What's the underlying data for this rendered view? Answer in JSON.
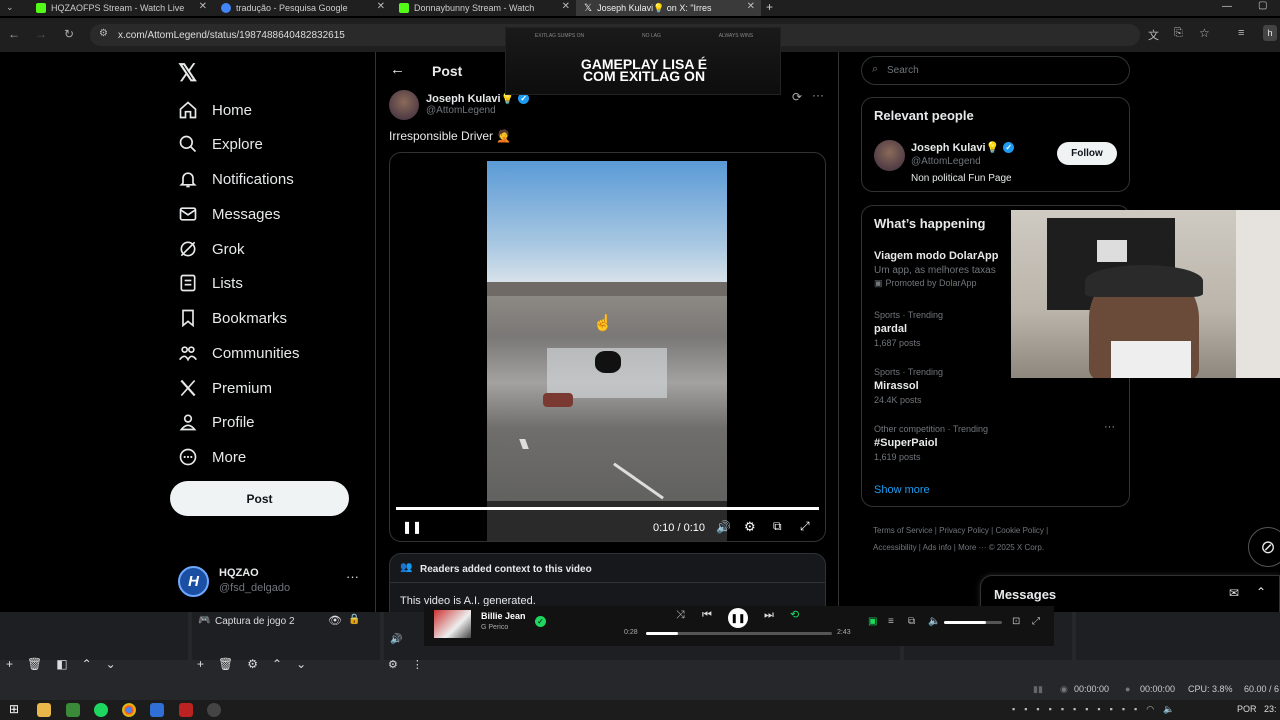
{
  "browser": {
    "tabs": [
      {
        "label": "HQZAOFPS Stream - Watch Live",
        "color": "#53fc18"
      },
      {
        "label": "tradução - Pesquisa Google",
        "color": "#4285f4"
      },
      {
        "label": "Donnaybunny Stream - Watch",
        "color": "#53fc18"
      },
      {
        "label": "Joseph Kulavi💡 on X: \"Irres",
        "color": "#ffffff"
      }
    ],
    "url": "x.com/AttomLegend/status/1987488640482832615"
  },
  "overlay_banner": {
    "top_labels": [
      "EXITLAG SUMPS ON",
      "NO LAG",
      "ALWAYS WINS"
    ],
    "text_line1": "GAMEPLAY LISA É",
    "text_line2": "COM EXITLAG ON"
  },
  "sidebar": {
    "items": [
      {
        "label": "Home",
        "icon": "home-icon"
      },
      {
        "label": "Explore",
        "icon": "search-icon"
      },
      {
        "label": "Notifications",
        "icon": "bell-icon"
      },
      {
        "label": "Messages",
        "icon": "mail-icon"
      },
      {
        "label": "Grok",
        "icon": "grok-icon"
      },
      {
        "label": "Lists",
        "icon": "list-icon"
      },
      {
        "label": "Bookmarks",
        "icon": "bookmark-icon"
      },
      {
        "label": "Communities",
        "icon": "communities-icon"
      },
      {
        "label": "Premium",
        "icon": "x-icon"
      },
      {
        "label": "Profile",
        "icon": "person-icon"
      },
      {
        "label": "More",
        "icon": "more-circle-icon"
      }
    ],
    "post_label": "Post",
    "account": {
      "name": "HQZAO",
      "handle": "@fsd_delgado",
      "initial": "H"
    }
  },
  "post": {
    "header_title": "Post",
    "author_name": "Joseph Kulavi💡",
    "author_handle": "@AttomLegend",
    "text": "Irresponsible Driver 🤦",
    "video_time": "0:10 / 0:10",
    "video_progress": 1.0,
    "community_note_title": "Readers added context to this video",
    "community_note_text": "This video is A.I. generated."
  },
  "right": {
    "search_placeholder": "Search",
    "relevant_title": "Relevant people",
    "person": {
      "name": "Joseph Kulavi💡",
      "handle": "@AttomLegend",
      "bio": "Non political Fun Page",
      "follow_label": "Follow"
    },
    "happening_title": "What’s happening",
    "promo": {
      "title": "Viagem modo DolarApp",
      "subtitle": "Um app, as melhores taxas",
      "promoted": "Promoted by DolarApp"
    },
    "trends": [
      {
        "meta": "Sports · Trending",
        "title": "pardal",
        "count": "1,687 posts"
      },
      {
        "meta": "Sports · Trending",
        "title": "Mirassol",
        "count": "24.4K posts"
      },
      {
        "meta": "Other competition · Trending",
        "title": "#SuperPaiol",
        "count": "1,619 posts"
      }
    ],
    "show_more": "Show more",
    "footer_links": [
      "Terms of Service",
      "Privacy Policy",
      "Cookie Policy",
      "Accessibility",
      "Ads info",
      "More ···",
      "© 2025 X Corp."
    ],
    "messages_label": "Messages"
  },
  "obs": {
    "source_name": "Captura de jogo 2",
    "track_title": "Billie Jean",
    "track_artist": "G Perico",
    "time_elapsed": "0:28",
    "time_total": "2:43",
    "track_progress": 0.17,
    "status_time1": "00:00:00",
    "status_time2": "00:00:00",
    "cpu": "CPU: 3.8%",
    "fps": "60.00 / 6"
  },
  "taskbar": {
    "lang": "POR",
    "clock": "23:"
  },
  "colors": {
    "x_blue": "#1d9bf0",
    "bg": "#000000",
    "border": "#2f3336",
    "muted": "#71767b",
    "note_bg": "#16181c"
  }
}
